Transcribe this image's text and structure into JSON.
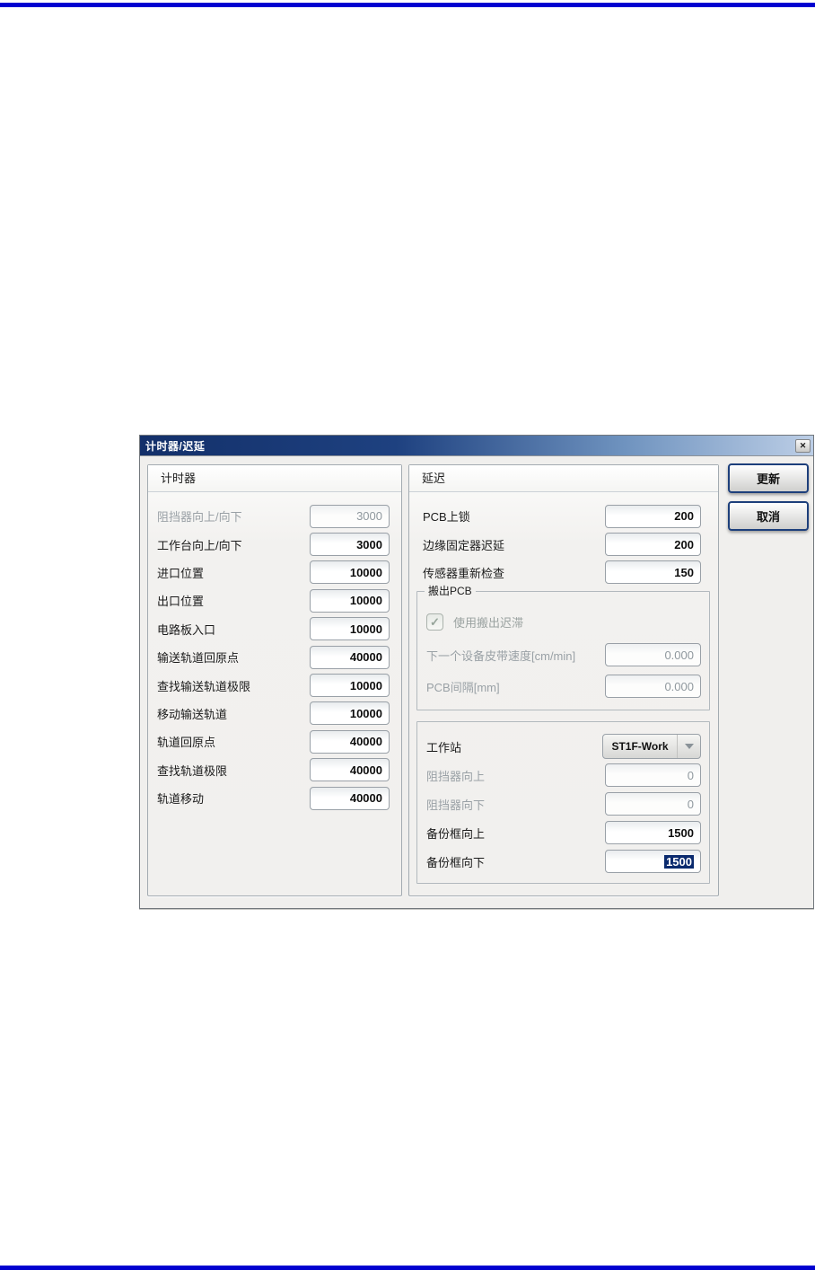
{
  "colors": {
    "rule_blue": "#0101d0",
    "titlebar_navy": "#13306a",
    "selection_navy": "#0a2a6e",
    "button_border_navy": "#1d3f7b"
  },
  "dialog": {
    "title": "计时器/迟延",
    "close_icon": "✕",
    "update_button": "更新",
    "cancel_button": "取消"
  },
  "timer_panel": {
    "title": "计时器",
    "rows": [
      {
        "label": "阻挡器向上/向下",
        "value": "3000",
        "disabled": true
      },
      {
        "label": "工作台向上/向下",
        "value": "3000",
        "disabled": false
      },
      {
        "label": "进口位置",
        "value": "10000",
        "disabled": false
      },
      {
        "label": "出口位置",
        "value": "10000",
        "disabled": false
      },
      {
        "label": "电路板入口",
        "value": "10000",
        "disabled": false
      },
      {
        "label": "输送轨道回原点",
        "value": "40000",
        "disabled": false
      },
      {
        "label": "查找输送轨道极限",
        "value": "10000",
        "disabled": false
      },
      {
        "label": "移动输送轨道",
        "value": "10000",
        "disabled": false
      },
      {
        "label": "轨道回原点",
        "value": "40000",
        "disabled": false
      },
      {
        "label": "查找轨道极限",
        "value": "40000",
        "disabled": false
      },
      {
        "label": "轨道移动",
        "value": "40000",
        "disabled": false
      }
    ]
  },
  "delay_panel": {
    "title": "延迟",
    "rows": [
      {
        "label": "PCB上锁",
        "value": "200",
        "disabled": false
      },
      {
        "label": "边缘固定器迟延",
        "value": "200",
        "disabled": false
      },
      {
        "label": "传感器重新检查",
        "value": "150",
        "disabled": false
      }
    ],
    "unload_group": {
      "title": "搬出PCB",
      "checkbox_label": "使用搬出迟滞",
      "checkbox_checked": true,
      "check_icon": "✓",
      "rows": [
        {
          "label": "下一个设备皮带速度[cm/min]",
          "value": "0.000",
          "disabled": true
        },
        {
          "label": "PCB间隔[mm]",
          "value": "0.000",
          "disabled": true
        }
      ]
    },
    "station_group": {
      "station_label": "工作站",
      "station_value": "ST1F-Work",
      "rows": [
        {
          "label": "阻挡器向上",
          "value": "0",
          "disabled": true
        },
        {
          "label": "阻挡器向下",
          "value": "0",
          "disabled": true
        },
        {
          "label": "备份框向上",
          "value": "1500",
          "disabled": false
        },
        {
          "label": "备份框向下",
          "value": "1500",
          "disabled": false,
          "selected": true
        }
      ]
    }
  }
}
